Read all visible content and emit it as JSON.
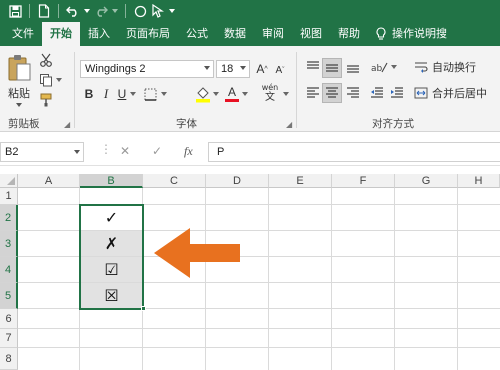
{
  "app": {
    "accent": "#217346",
    "arrow_color": "#e8711f"
  },
  "qat": {
    "icons": [
      "save-icon",
      "new-file-icon",
      "undo-icon",
      "redo-icon",
      "shape-icon",
      "pointer-icon"
    ]
  },
  "tabs": [
    {
      "label": "文件",
      "active": false
    },
    {
      "label": "开始",
      "active": true
    },
    {
      "label": "插入",
      "active": false
    },
    {
      "label": "页面布局",
      "active": false
    },
    {
      "label": "公式",
      "active": false
    },
    {
      "label": "数据",
      "active": false
    },
    {
      "label": "审阅",
      "active": false
    },
    {
      "label": "视图",
      "active": false
    },
    {
      "label": "帮助",
      "active": false
    }
  ],
  "tell_me": {
    "label": "操作说明搜",
    "icon": "lightbulb-icon"
  },
  "ribbon": {
    "clipboard": {
      "paste_label": "粘贴",
      "group_label": "剪贴板"
    },
    "font": {
      "name": "Wingdings 2",
      "size": "18",
      "grow": "A",
      "shrink": "A",
      "bold": "B",
      "italic": "I",
      "underline": "U",
      "font_color": "A",
      "phonetic": "wén",
      "group_label": "字体"
    },
    "alignment": {
      "wrap_label": "自动换行",
      "merge_label": "合并后居中",
      "group_label": "对齐方式"
    }
  },
  "formula_bar": {
    "name_box": "B2",
    "cancel": "✕",
    "enter": "✓",
    "fx": "fx",
    "content": "P"
  },
  "grid": {
    "columns": [
      "A",
      "B",
      "C",
      "D",
      "E",
      "F",
      "G",
      "H"
    ],
    "selected_column": "B",
    "rows": [
      "1",
      "2",
      "3",
      "4",
      "5",
      "6",
      "7",
      "8"
    ],
    "selected_rows": [
      "2",
      "3",
      "4",
      "5"
    ],
    "cells": {
      "B2": "✓",
      "B3": "✗",
      "B4": "☑",
      "B5": "☒"
    }
  }
}
